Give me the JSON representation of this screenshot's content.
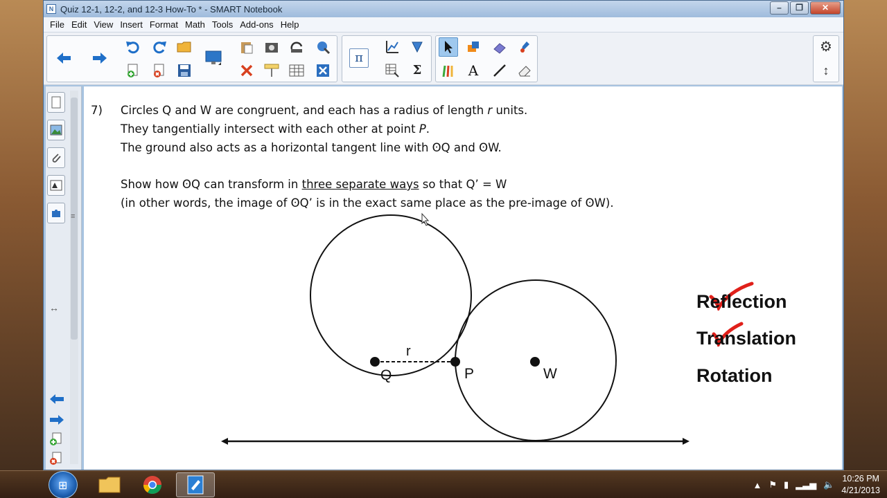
{
  "window": {
    "title": "Quiz 12-1, 12-2, and 12-3 How-To * - SMART Notebook",
    "app_icon": "N"
  },
  "menu": [
    "File",
    "Edit",
    "View",
    "Insert",
    "Format",
    "Math",
    "Tools",
    "Add-ons",
    "Help"
  ],
  "toolbar": {
    "icons": [
      "back-arrow-icon",
      "forward-arrow-icon",
      "undo-icon",
      "redo-icon",
      "open-folder-icon",
      "add-page-icon",
      "delete-page-icon",
      "save-icon",
      "screen-shade-icon",
      "paste-icon",
      "screen-capture-icon",
      "doc-camera-icon",
      "capture-tool-icon",
      "delete-icon",
      "screen-icon",
      "table-icon",
      "close-icon",
      "pi-icon",
      "graph-icon",
      "shapes-icon",
      "table-tool-icon",
      "sigma-icon",
      "select-arrow-icon",
      "fill-icon",
      "eraser-icon",
      "pen-icon",
      "creative-pens-icon",
      "text-icon",
      "line-icon",
      "magic-eraser-icon",
      "gear-icon",
      "up-down-arrow-icon"
    ],
    "pi": "π",
    "sigma": "Σ",
    "text_tool": "A"
  },
  "question": {
    "number": "7)",
    "line1_a": "Circles Q and W are congruent, and each has a radius of length ",
    "line1_r": "r",
    "line1_b": " units.",
    "line2_a": "They tangentially intersect with each other at point ",
    "line2_p": "P",
    "line2_b": ".",
    "line3": "The ground also acts as a horizontal tangent line with ʘQ and ʘW.",
    "line4_a": "Show how ʘQ can transform in ",
    "line4_u": "three separate ways",
    "line4_b": " so that Q’ = W",
    "line5": "(in other words, the image of ʘQ’ is in the exact same place as the pre-image of ʘW)."
  },
  "diagram": {
    "label_r": "r",
    "label_q": "Q",
    "label_p": "P",
    "label_w": "W"
  },
  "answers": [
    {
      "label": "Reflection",
      "checked": true
    },
    {
      "label": "Translation",
      "checked": true
    },
    {
      "label": "Rotation",
      "checked": false
    }
  ],
  "colors": {
    "check": "#e0201a",
    "selected_tool": "#9fc8ee"
  },
  "taskbar": {
    "time": "10:26 PM",
    "date": "4/21/2013"
  }
}
